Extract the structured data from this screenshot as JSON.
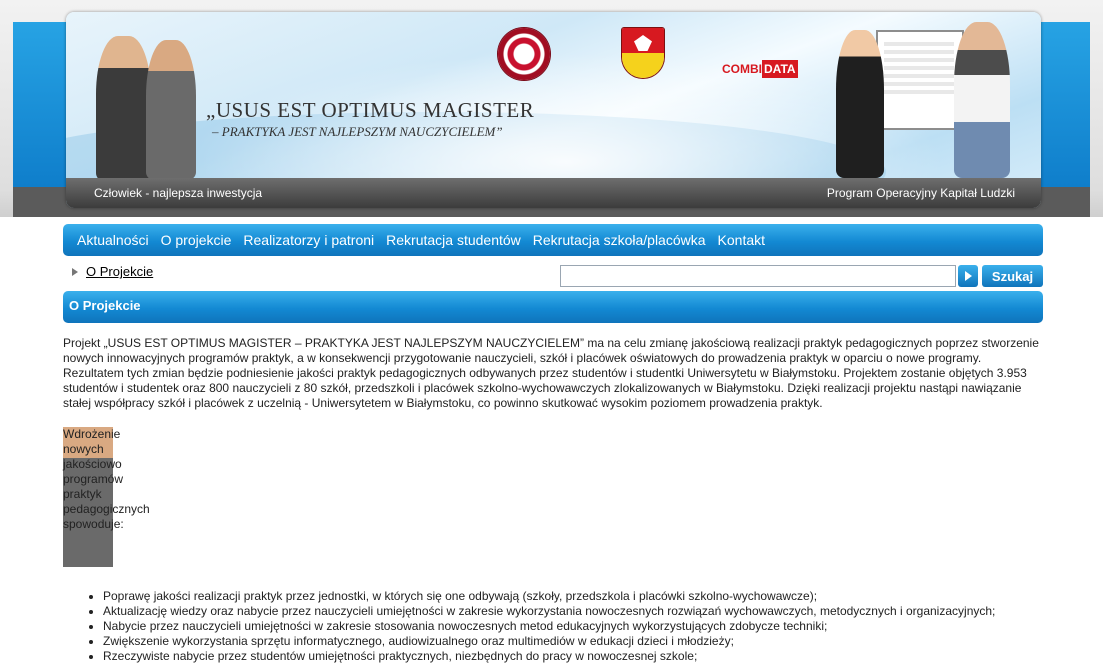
{
  "header": {
    "slogan_main": "„USUS EST OPTIMUS MAGISTER",
    "slogan_sub": "– PRAKTYKA JEST NAJLEPSZYM NAUCZYCIELEM”",
    "footer_left": "Człowiek - najlepsza inwestycja",
    "footer_right": "Program Operacyjny Kapitał Ludzki",
    "partner_logo_left": "COMBI",
    "partner_logo_right": "DATA",
    "logos": [
      "university-crest-icon",
      "bialystok-coat-of-arms-icon",
      "combidata-logo-icon"
    ]
  },
  "nav": {
    "items": [
      {
        "label": "Aktualności"
      },
      {
        "label": "O projekcie"
      },
      {
        "label": "Realizatorzy i patroni"
      },
      {
        "label": "Rekrutacja studentów"
      },
      {
        "label": "Rekrutacja szkoła/placówka"
      },
      {
        "label": "Kontakt"
      }
    ]
  },
  "breadcrumb": {
    "current": "O Projekcie"
  },
  "search": {
    "value": "",
    "placeholder": "",
    "button_label": "Szukaj"
  },
  "section": {
    "title": "O Projekcie",
    "paragraph1": "Projekt „USUS EST OPTIMUS MAGISTER – PRAKTYKA JEST NAJLEPSZYM NAUCZYCIELEM” ma na celu zmianę jakościową realizacji  praktyk pedagogicznych poprzez stworzenie nowych innowacyjnych programów praktyk, a w konsekwencji przygotowanie nauczycieli, szkół i placówek oświatowych do prowadzenia praktyk w oparciu o nowe programy. Rezultatem tych zmian  będzie   podniesienie jakości praktyk pedagogicznych odbywanych przez studentów i studentki Uniwersytetu w Białymstoku. Projektem zostanie objętych 3.953 studentów i studentek oraz 800 nauczycieli z 80 szkół, przedszkoli i placówek szkolno-wychowawczych zlokalizowanych w Białymstoku. Dzięki realizacji projektu nastąpi nawiązanie stałej współpracy szkół i placówek z uczelnią - Uniwersytetem w Białymstoku, co powinno skutkować wysokim poziomem prowadzenia praktyk.",
    "paragraph2": "Wdrożenie nowych jakościowo programów praktyk pedagogicznych  spowoduje:",
    "bullets": [
      "Poprawę jakości realizacji praktyk przez jednostki, w których się one odbywają (szkoły, przedszkola i placówki szkolno-wychowawcze);",
      "Aktualizację wiedzy oraz nabycie przez  nauczycieli umiejętności w zakresie wykorzystania nowoczesnych rozwiązań wychowawczych, metodycznych i organizacyjnych;",
      " Nabycie przez nauczycieli umiejętności w zakresie stosowania nowoczesnych metod edukacyjnych wykorzystujących zdobycze techniki;",
      "Zwiększenie wykorzystania sprzętu informatycznego, audiowizualnego oraz multimediów  w edukacji dzieci i młodzieży;",
      "Rzeczywiste nabycie przez studentów  umiejętności praktycznych, niezbędnych do pracy w nowoczesnej szkole;"
    ]
  },
  "colors": {
    "accent_blue": "#1389d3",
    "banner_dark": "#4a4a4a"
  }
}
